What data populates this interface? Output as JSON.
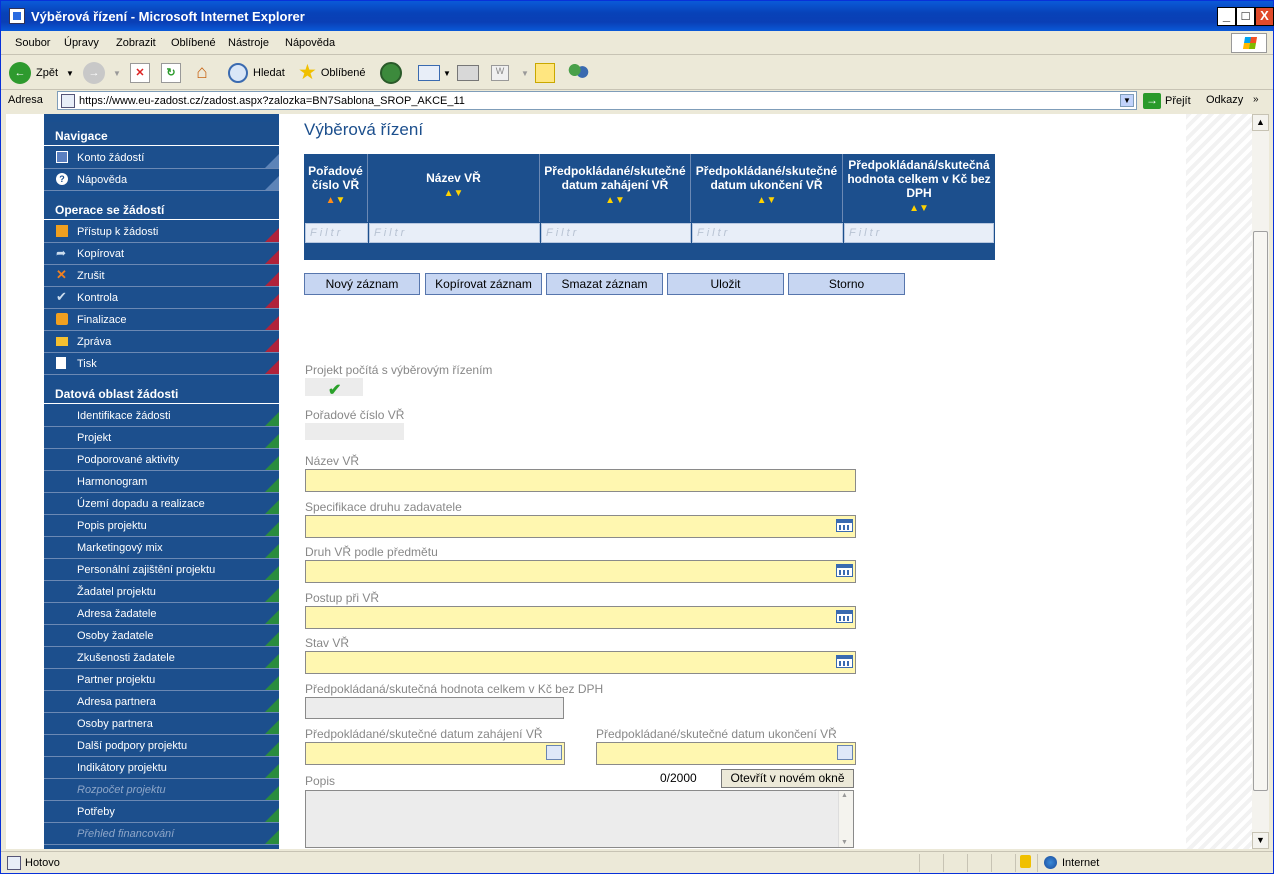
{
  "window": {
    "title": "Výběrová řízení - Microsoft Internet Explorer",
    "min_label": "_",
    "max_label": "□",
    "close_label": "X"
  },
  "menu": [
    "Soubor",
    "Úpravy",
    "Zobrazit",
    "Oblíbené",
    "Nástroje",
    "Nápověda"
  ],
  "toolbar": {
    "back": "Zpět",
    "search": "Hledat",
    "favorites": "Oblíbené"
  },
  "address": {
    "label": "Adresa",
    "url": "https://www.eu-zadost.cz/zadost.aspx?zalozka=BN7Sablona_SROP_AKCE_11",
    "go": "Přejít",
    "links": "Odkazy"
  },
  "sidebar": {
    "nav_header": "Navigace",
    "nav_items": [
      "Konto žádostí",
      "Nápověda"
    ],
    "ops_header": "Operace se žádostí",
    "ops_items": [
      "Přístup k žádosti",
      "Kopírovat",
      "Zrušit",
      "Kontrola",
      "Finalizace",
      "Zpráva",
      "Tisk"
    ],
    "data_header": "Datová oblast žádosti",
    "data_items": [
      "Identifikace žádosti",
      "Projekt",
      "Podporované aktivity",
      "Harmonogram",
      "Území dopadu a realizace",
      "Popis projektu",
      "Marketingový mix",
      "Personální zajištění projektu",
      "Žadatel projektu",
      "Adresa žadatele",
      "Osoby žadatele",
      "Zkušenosti žadatele",
      "Partner projektu",
      "Adresa partnera",
      "Osoby partnera",
      "Další podpory projektu",
      "Indikátory projektu",
      "Rozpočet projektu",
      "Potřeby",
      "Přehled financování"
    ]
  },
  "main": {
    "title": "Výběrová řízení",
    "grid": {
      "columns": [
        "Pořadové číslo VŘ",
        "Název VŘ",
        "Předpokládané/skutečné datum zahájení VŘ",
        "Předpokládané/skutečné datum ukončení VŘ",
        "Předpokládaná/skutečná hodnota celkem v Kč bez DPH"
      ],
      "filter_placeholder": "Filtr"
    },
    "buttons": {
      "new": "Nový záznam",
      "copy": "Kopírovat záznam",
      "delete": "Smazat záznam",
      "save": "Uložit",
      "cancel": "Storno"
    },
    "form": {
      "has_tender_label": "Projekt počítá s výběrovým řízením",
      "order_label": "Pořadové číslo VŘ",
      "name_label": "Název VŘ",
      "spec_label": "Specifikace druhu zadavatele",
      "kind_label": "Druh VŘ podle předmětu",
      "procedure_label": "Postup při VŘ",
      "state_label": "Stav VŘ",
      "value_label": "Předpokládaná/skutečná hodnota celkem v Kč bez DPH",
      "start_label": "Předpokládané/skutečné datum zahájení VŘ",
      "end_label": "Předpokládané/skutečné datum ukončení VŘ",
      "desc_label": "Popis",
      "desc_counter": "0/2000",
      "open_window": "Otevřít v novém okně"
    }
  },
  "status": {
    "text": "Hotovo",
    "zone": "Internet"
  }
}
